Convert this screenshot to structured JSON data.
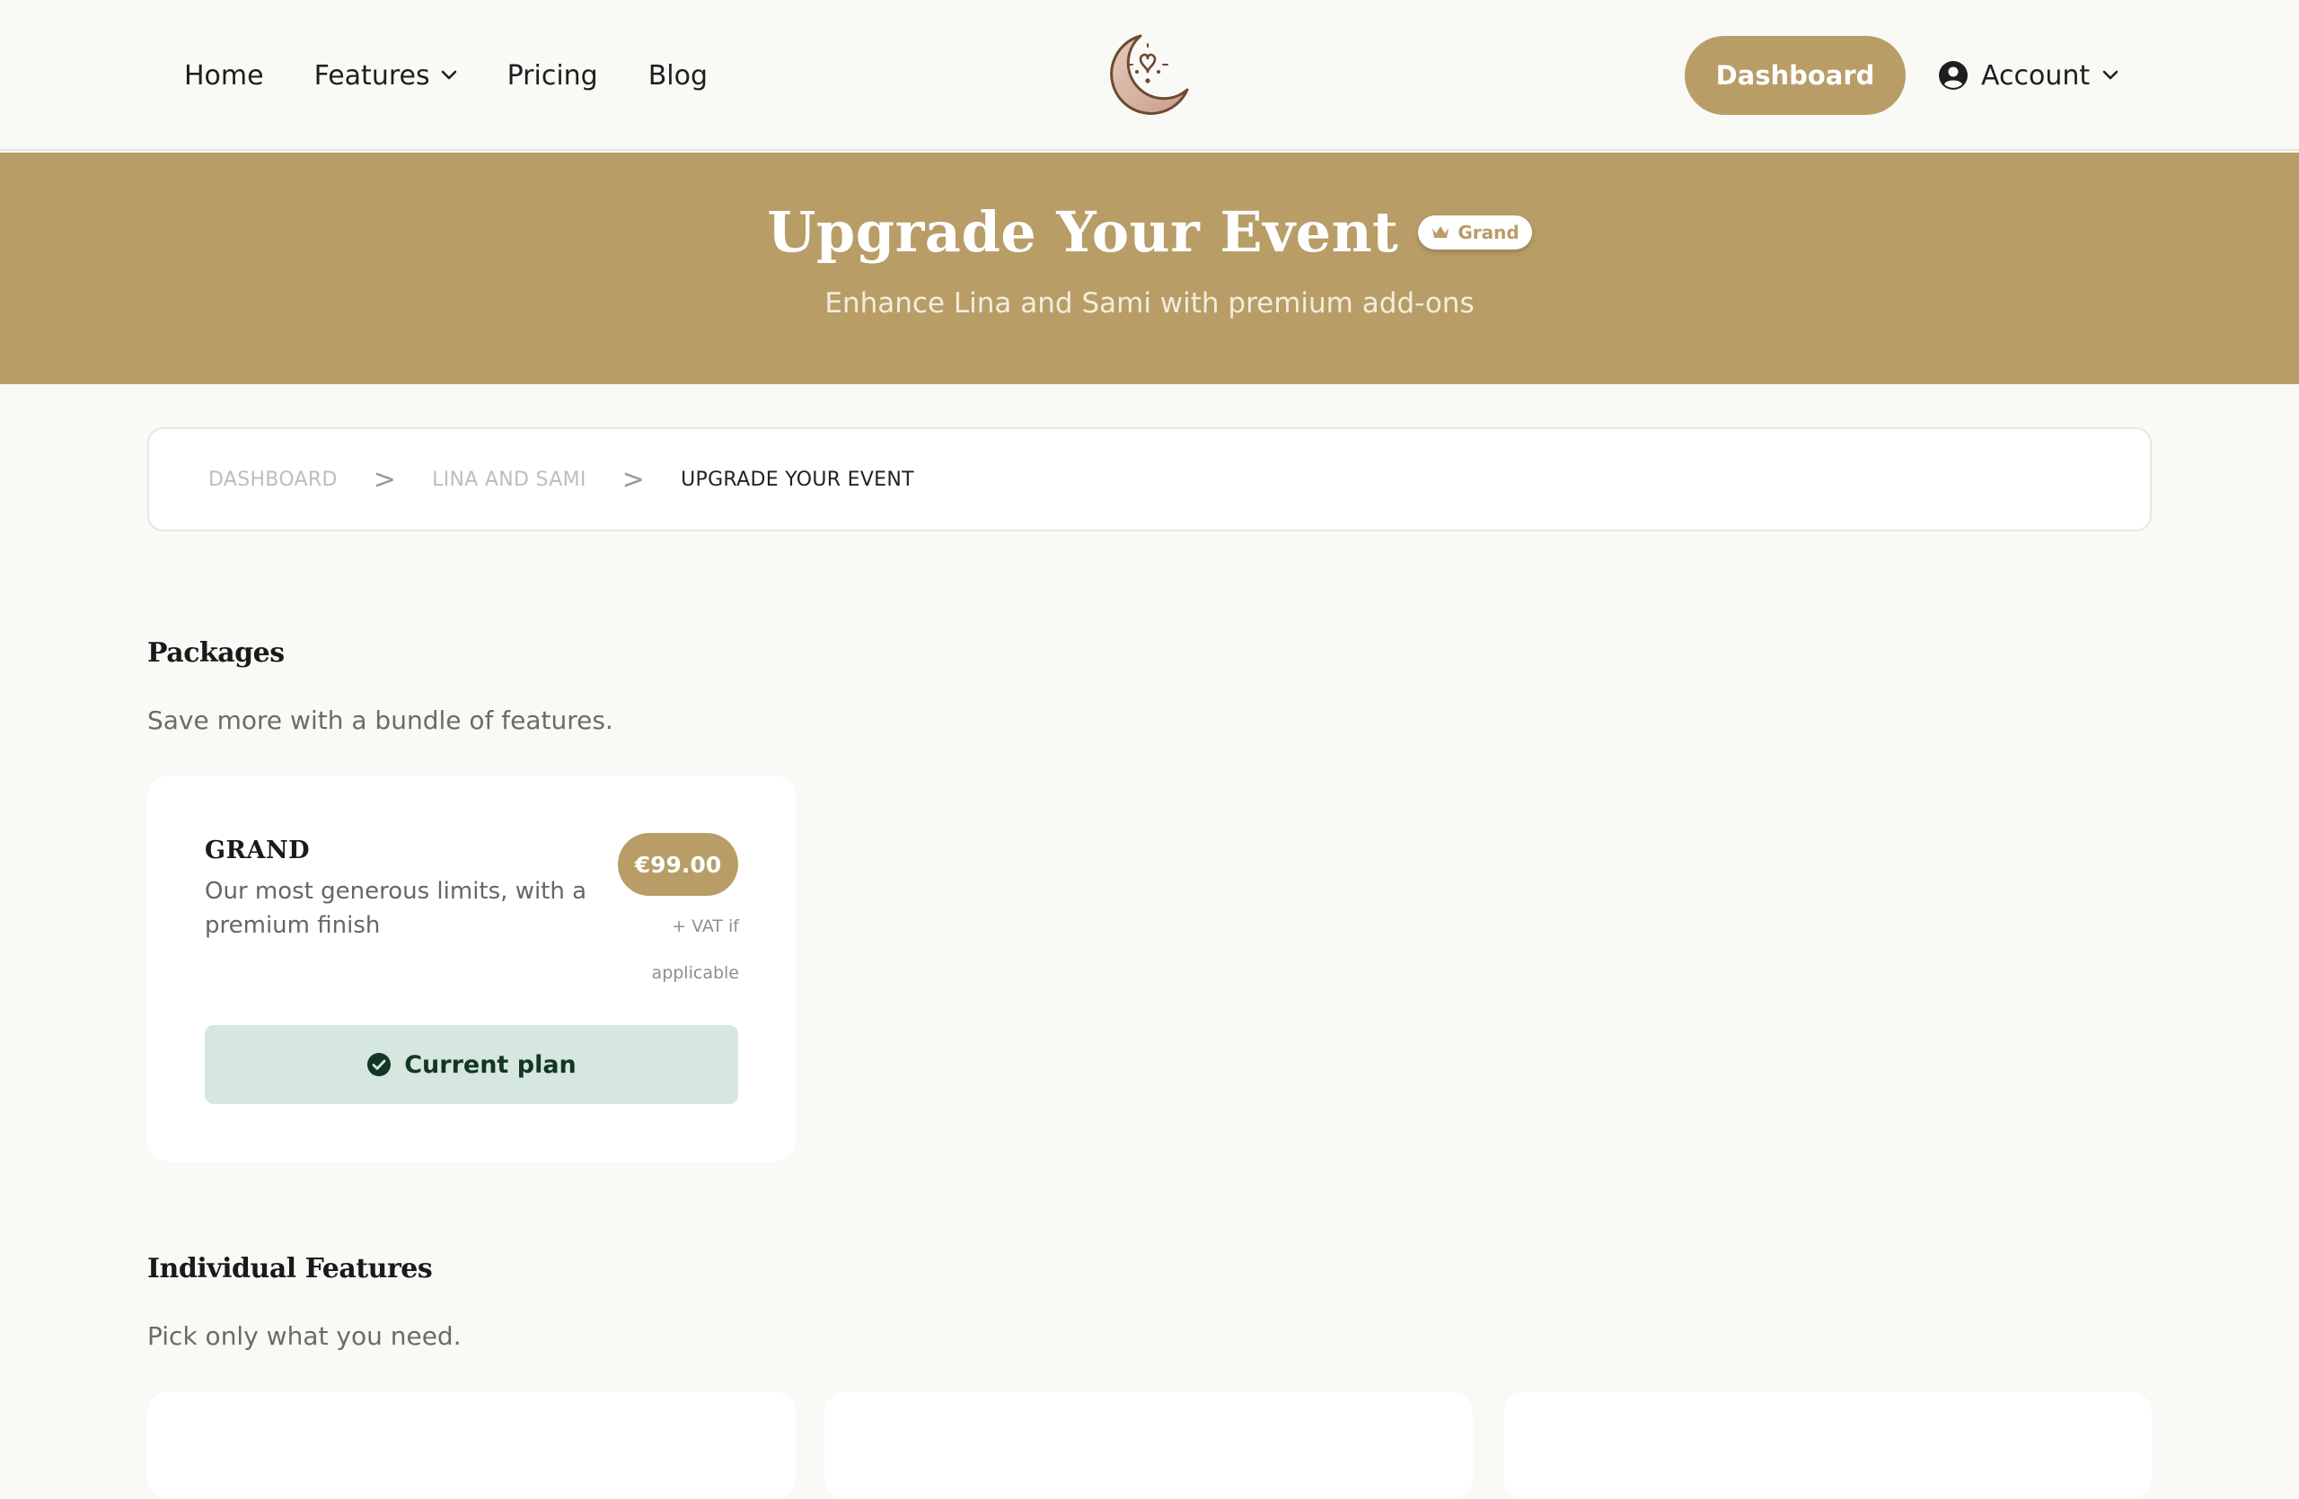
{
  "nav": {
    "links": [
      {
        "label": "Home"
      },
      {
        "label": "Features",
        "has_dropdown": true
      },
      {
        "label": "Pricing"
      },
      {
        "label": "Blog"
      }
    ],
    "dashboard_label": "Dashboard",
    "account_label": "Account",
    "logo_icon": "moon-heart-logo"
  },
  "hero": {
    "title": "Upgrade Your Event",
    "badge": "Grand",
    "subtitle": "Enhance Lina and Sami with premium add-ons"
  },
  "breadcrumb": [
    {
      "label": "DASHBOARD"
    },
    {
      "label": "LINA AND SAMI"
    },
    {
      "label": "UPGRADE YOUR EVENT"
    }
  ],
  "breadcrumb_separator": ">",
  "packages": {
    "title": "Packages",
    "subtitle": "Save more with a bundle of features.",
    "items": [
      {
        "name": "GRAND",
        "description": "Our most generous limits, with a premium finish",
        "price": "€99.00",
        "vat_note": "+ VAT if applicable",
        "button_label": "Current plan"
      }
    ]
  },
  "features": {
    "title": "Individual Features",
    "subtitle": "Pick only what you need."
  },
  "colors": {
    "accent": "#b89d67",
    "background": "#f9f9f6",
    "current_plan_bg": "#d5e7df",
    "current_plan_text": "#133626"
  }
}
